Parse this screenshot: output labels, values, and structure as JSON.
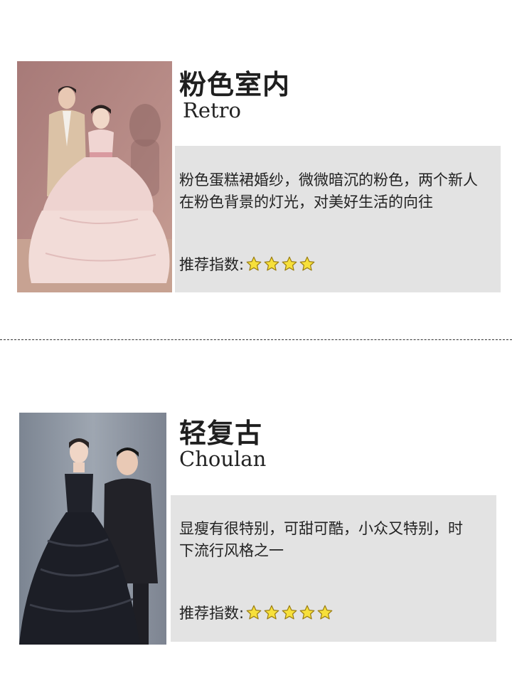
{
  "cards": [
    {
      "title": "粉色室内",
      "subtitle": "Retro",
      "description": "粉色蛋糕裙婚纱，微微暗沉的粉色，两个新人在粉色背景的灯光，对美好生活的向往",
      "rating_label": "推荐指数:",
      "rating": 4,
      "photo_colors": {
        "background": "#b08580",
        "dress": "#eed3d0",
        "suit": "#dbc2a6"
      }
    },
    {
      "title": "轻复古",
      "subtitle": "Choulan",
      "description": "显瘦有很特别，可甜可酷，小众又特别，时下流行风格之一",
      "rating_label": "推荐指数:",
      "rating": 5,
      "photo_colors": {
        "background": "#8f97a3",
        "dress": "#1c1e26",
        "suit": "#222228"
      }
    }
  ],
  "colors": {
    "star": "#f7e03a",
    "star_outline": "#9a7d12",
    "info_box": "#e3e3e3"
  }
}
